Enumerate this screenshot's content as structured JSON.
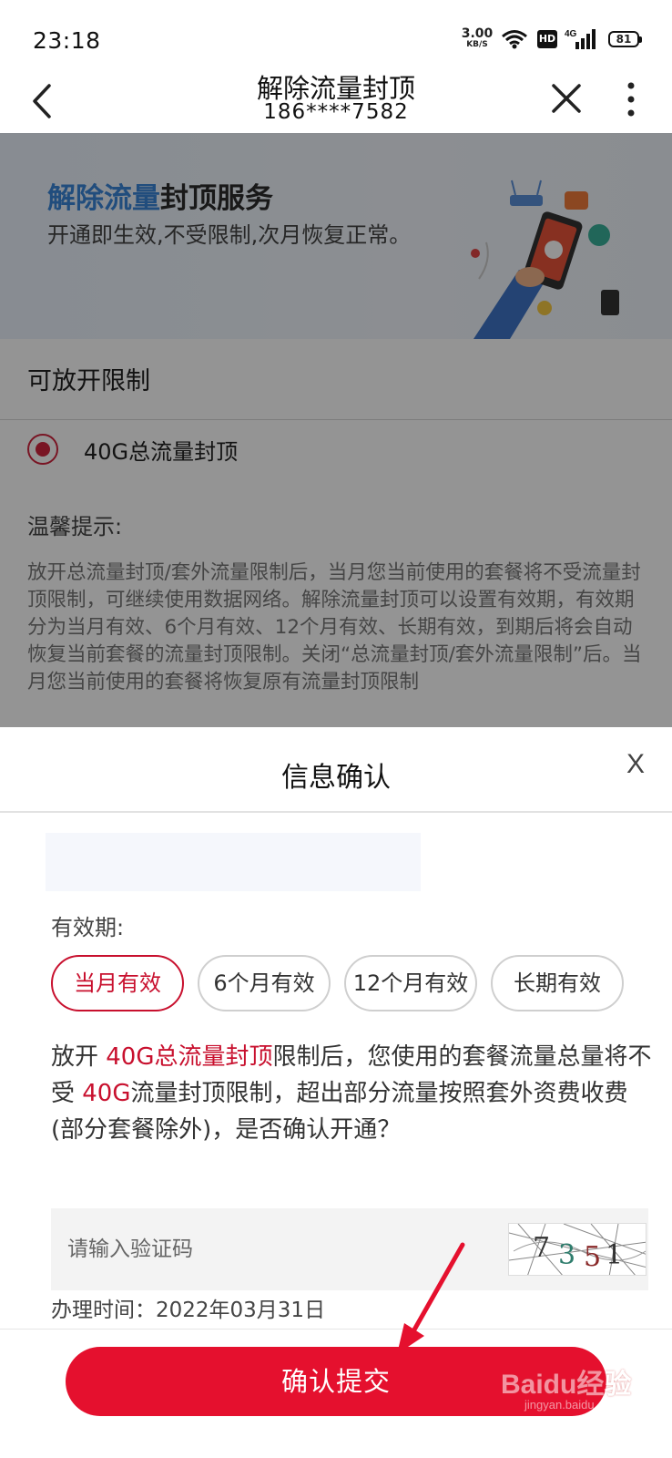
{
  "status_bar": {
    "time": "23:18",
    "speed_value": "3.00",
    "speed_unit": "KB/S",
    "hd": "HD",
    "network": "4G",
    "battery": "81"
  },
  "nav": {
    "title": "解除流量封顶",
    "phone": "186****7582"
  },
  "banner": {
    "title_highlight": "解除流量",
    "title_rest": "封顶服务",
    "subtitle": "开通即生效,不受限制,次月恢复正常。"
  },
  "page": {
    "section_title": "可放开限制",
    "option_label": "40G总流量封顶",
    "tips_title": "温馨提示:",
    "tips_body": "放开总流量封顶/套外流量限制后，当月您当前使用的套餐将不受流量封顶限制，可继续使用数据网络。解除流量封顶可以设置有效期，有效期分为当月有效、6个月有效、12个月有效、长期有效，到期后将会自动恢复当前套餐的流量封顶限制。关闭“总流量封顶/套外流量限制”后。当月您当前使用的套餐将恢复原有流量封顶限制"
  },
  "sheet": {
    "title": "信息确认",
    "close": "X",
    "validity_label": "有效期:",
    "chips": [
      "当月有效",
      "6个月有效",
      "12个月有效",
      "长期有效"
    ],
    "selected_chip": "当月有效",
    "desc_part1": "放开 ",
    "desc_red1": "40G总流量封顶",
    "desc_part2": "限制后，您使用的套餐流量总量将不受 ",
    "desc_red2": "40G",
    "desc_part3": "流量封顶限制，超出部分流量按照套外资费收费(部分套餐除外)，是否确认开通？",
    "captcha_placeholder": "请输入验证码",
    "captcha_code": "7351",
    "handle_time": "办理时间：2022年03月31日",
    "submit_label": "确认提交"
  },
  "watermark": {
    "main": "Baidu经验",
    "sub": "jingyan.baidu.com"
  },
  "colors": {
    "accent_red": "#c8102e",
    "button_red": "#e5102e",
    "link_blue": "#3a86d8"
  }
}
